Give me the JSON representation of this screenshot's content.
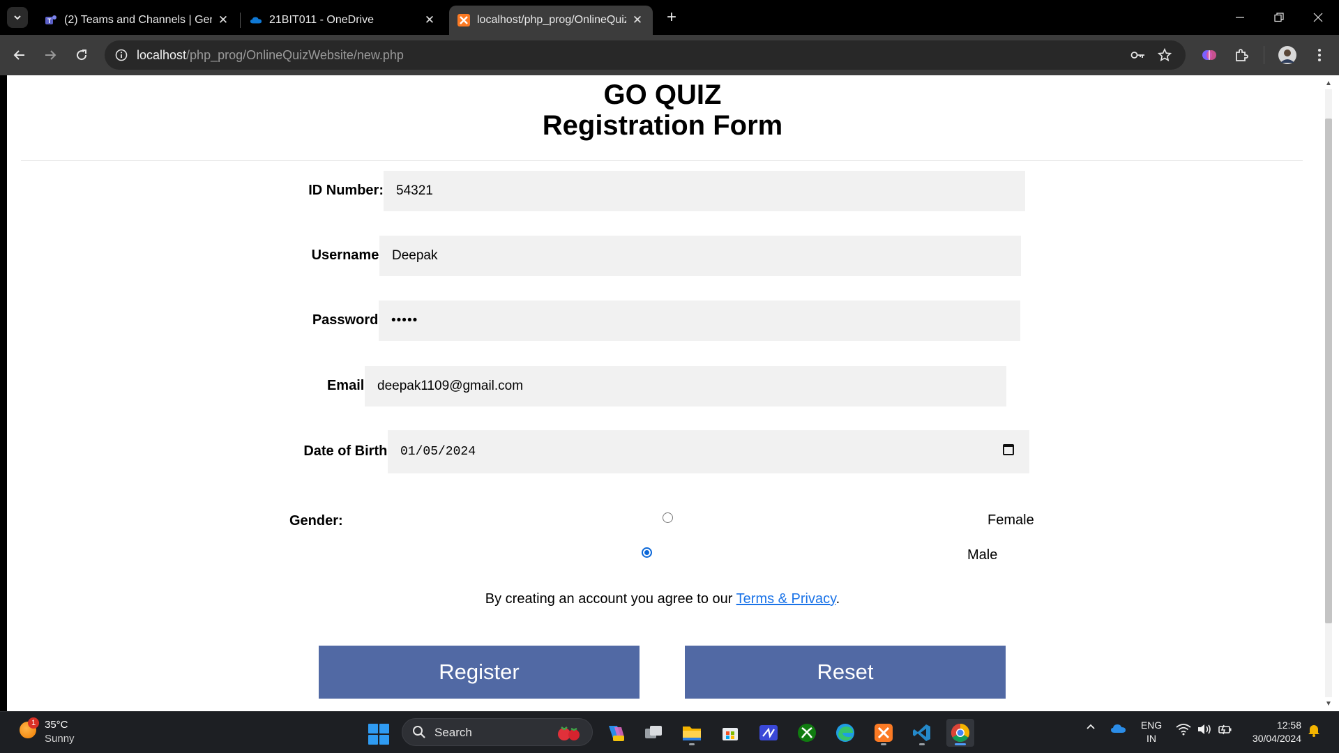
{
  "browser": {
    "tabs": [
      {
        "title": "(2) Teams and Channels | Gener",
        "active": false
      },
      {
        "title": "21BIT011 - OneDrive",
        "active": false
      },
      {
        "title": "localhost/php_prog/OnlineQuiz",
        "active": true
      }
    ],
    "new_tab_label": "+",
    "url_host": "localhost",
    "url_path": "/php_prog/OnlineQuizWebsite/new.php"
  },
  "page": {
    "brand": "GO QUIZ",
    "title": "Registration Form",
    "fields": {
      "id_label": "ID Number:",
      "id_value": "54321",
      "username_label": "Username:",
      "username_value": "Deepak",
      "password_label": "Password:",
      "password_value": "•••••",
      "email_label": "Email:",
      "email_value": "deepak1109@gmail.com",
      "dob_label": "Date of Birth:",
      "dob_value": "01/05/2024"
    },
    "gender": {
      "label": "Gender:",
      "options": [
        {
          "label": "Female",
          "checked": false
        },
        {
          "label": "Male",
          "checked": true
        }
      ]
    },
    "terms_prefix": "By creating an account you agree to our ",
    "terms_link": "Terms & Privacy",
    "terms_suffix": ".",
    "register_label": "Register",
    "reset_label": "Reset"
  },
  "taskbar": {
    "weather_badge": "1",
    "temperature": "35°C",
    "condition": "Sunny",
    "search_label": "Search",
    "language": "ENG",
    "region": "IN",
    "time": "12:58",
    "date": "30/04/2024"
  },
  "colors": {
    "button": "#5169a4",
    "input_bg": "#f1f1f1",
    "link": "#1a73e8",
    "radio_checked": "#0b67d8"
  }
}
